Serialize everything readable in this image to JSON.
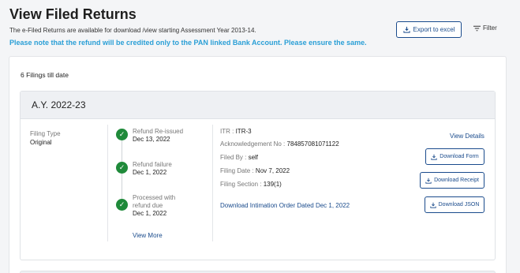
{
  "header": {
    "title": "View Filed Returns",
    "sub_info": "The e-Filed Returns are available for download /view starting Assessment Year 2013-14.",
    "refund_note": "Please note that the refund will be credited only to the PAN linked Bank Account. Please ensure the same.",
    "export_label": "Export to excel",
    "filter_label": "Filter"
  },
  "summary": {
    "count_text": "6 Filings till date"
  },
  "filing": {
    "ay": "A.Y. 2022-23",
    "filing_type_label": "Filing Type",
    "filing_type_value": "Original",
    "timeline": [
      {
        "status": "Refund Re-issued",
        "date": "Dec 13, 2022"
      },
      {
        "status": "Refund failure",
        "date": "Dec 1, 2022"
      },
      {
        "status": "Processed with refund due",
        "date": "Dec 1, 2022"
      }
    ],
    "view_more": "View More",
    "itr_label": "ITR :",
    "itr_value": "ITR-3",
    "ack_label": "Acknowledgement No :",
    "ack_value": "784857081071122",
    "filed_by_label": "Filed By :",
    "filed_by_value": "self",
    "filing_date_label": "Filing Date :",
    "filing_date_value": "Nov 7, 2022",
    "filing_section_label": "Filing Section :",
    "filing_section_value": "139(1)",
    "intimation_link": "Download Intimation Order Dated Dec 1, 2022",
    "view_details": "View Details",
    "download_form": "Download Form",
    "download_receipt": "Download Receipt",
    "download_json": "Download JSON"
  },
  "colors": {
    "accent": "#1a4b8c",
    "note": "#2a9fd6",
    "success": "#1f8a3a"
  },
  "icons": [
    "download-icon",
    "filter-icon",
    "check-icon"
  ]
}
